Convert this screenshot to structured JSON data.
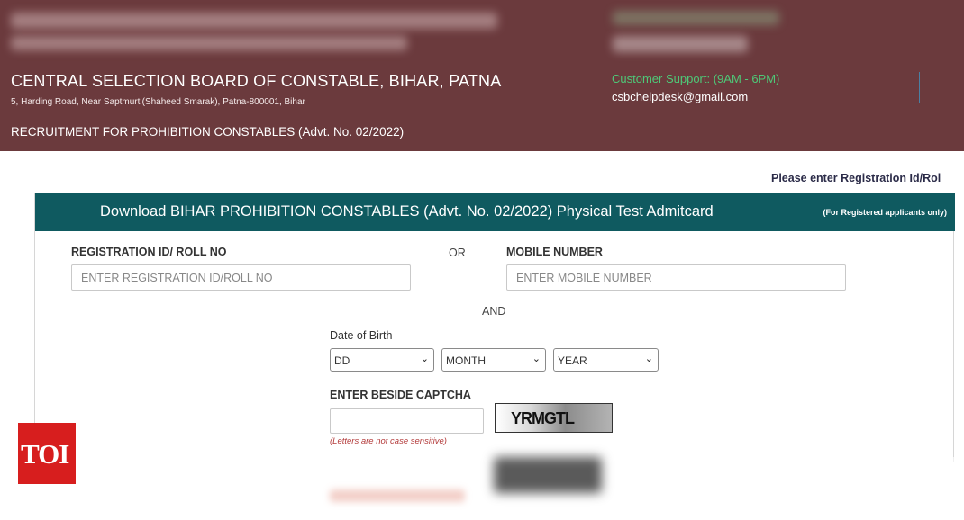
{
  "header": {
    "org_name": "CENTRAL SELECTION BOARD OF CONSTABLE, BIHAR, PATNA",
    "address": "5, Harding Road, Near Saptmurti(Shaheed Smarak), Patna-800001, Bihar",
    "recruitment": "RECRUITMENT FOR PROHIBITION CONSTABLES (Advt. No. 02/2022)",
    "support_label": "Customer Support: (9AM - 6PM)",
    "support_email": "csbchelpdesk@gmail.com"
  },
  "notice": "Please enter Registration Id/Rol",
  "panel": {
    "title": "Download BIHAR PROHIBITION CONSTABLES (Advt. No. 02/2022) Physical Test Admitcard",
    "note": "(For Registered applicants only)"
  },
  "form": {
    "reg_label": "REGISTRATION ID/ ROLL NO",
    "reg_placeholder": "ENTER REGISTRATION ID/ROLL NO",
    "or_text": "OR",
    "mobile_label": "MOBILE NUMBER",
    "mobile_placeholder": "ENTER MOBILE NUMBER",
    "and_text": "AND",
    "dob_label": "Date of Birth",
    "dob_day": "DD",
    "dob_month": "MONTH",
    "dob_year": "YEAR",
    "captcha_label": "ENTER BESIDE CAPTCHA",
    "captcha_text": "YRMGTL",
    "captcha_hint": "(Letters are not case sensitive)"
  },
  "logo": "TOI",
  "colors": {
    "header_bg": "#6b3a3d",
    "panel_head_bg": "#0f5a60",
    "support_green": "#4ec978",
    "hint_red": "#b33a3a",
    "logo_red": "#d71e1e"
  }
}
